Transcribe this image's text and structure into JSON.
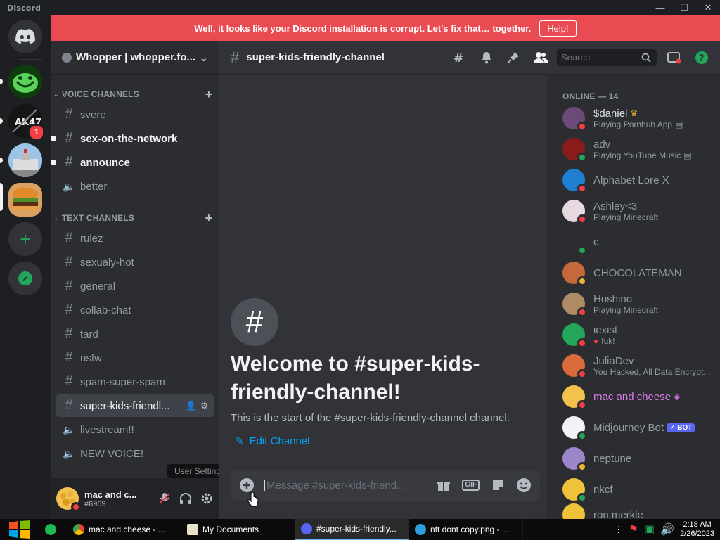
{
  "window": {
    "brand": "Discord"
  },
  "banner": {
    "message": "Well, it looks like your Discord installation is corrupt. Let's fix that… together.",
    "help_label": "Help!"
  },
  "rail": {
    "badge_count": "1"
  },
  "guild": {
    "name": "Whopper | whopper.fo..."
  },
  "categories": {
    "voice": "VOICE CHANNELS",
    "text": "TEXT CHANNELS"
  },
  "channels": {
    "voice": [
      {
        "label": "svere"
      },
      {
        "label": "sex-on-the-network"
      },
      {
        "label": "announce"
      },
      {
        "label": "better"
      }
    ],
    "text": [
      {
        "label": "rulez"
      },
      {
        "label": "sexualy-hot"
      },
      {
        "label": "general"
      },
      {
        "label": "collab-chat"
      },
      {
        "label": "tard"
      },
      {
        "label": "nsfw"
      },
      {
        "label": "spam-super-spam"
      },
      {
        "label": "super-kids-friendl..."
      },
      {
        "label": "livestream!!"
      },
      {
        "label": "NEW VOICE!"
      }
    ]
  },
  "user": {
    "name": "mac and c...",
    "tag": "#6969",
    "tooltip": "User Settings"
  },
  "header": {
    "channel": "super-kids-friendly-channel",
    "search_placeholder": "Search"
  },
  "welcome": {
    "title": "Welcome to #super-kids-friendly-channel!",
    "subtitle": "This is the start of the #super-kids-friendly-channel channel.",
    "edit_label": "Edit Channel"
  },
  "composer": {
    "placeholder": "Message #super-kids-friend...",
    "gif_label": "GIF"
  },
  "members": {
    "heading": "ONLINE — 14",
    "list": [
      {
        "name": "$daniel",
        "activity": "Playing Pornhub App"
      },
      {
        "name": "adv",
        "activity": "Playing YouTube Music"
      },
      {
        "name": "Alphabet Lore X",
        "activity": ""
      },
      {
        "name": "Ashley<3",
        "activity": "Playing Minecraft"
      },
      {
        "name": "c",
        "activity": ""
      },
      {
        "name": "CHOCOLATEMAN",
        "activity": ""
      },
      {
        "name": "Hoshino",
        "activity": "Playing Minecraft"
      },
      {
        "name": "iexist",
        "activity": "fuk!"
      },
      {
        "name": "JuliaDev",
        "activity": "You Hacked, All Data Encrypt..."
      },
      {
        "name": "mac and cheese",
        "activity": ""
      },
      {
        "name": "Midjourney Bot",
        "activity": "",
        "badge": "BOT"
      },
      {
        "name": "neptune",
        "activity": ""
      },
      {
        "name": "nkcf",
        "activity": ""
      },
      {
        "name": "ron merkle",
        "activity": ""
      }
    ]
  },
  "taskbar": {
    "items": [
      {
        "label": "mac and cheese - ..."
      },
      {
        "label": "My Documents"
      },
      {
        "label": "#super-kids-friendly..."
      },
      {
        "label": "nft dont copy.png - ..."
      }
    ],
    "time": "2:18 AM",
    "date": "2/26/2023"
  },
  "colors": {
    "accent": "#5865f2",
    "banner": "#ea4b52",
    "link": "#00a8fc",
    "dnd": "#f23f43",
    "online": "#23a55a"
  }
}
